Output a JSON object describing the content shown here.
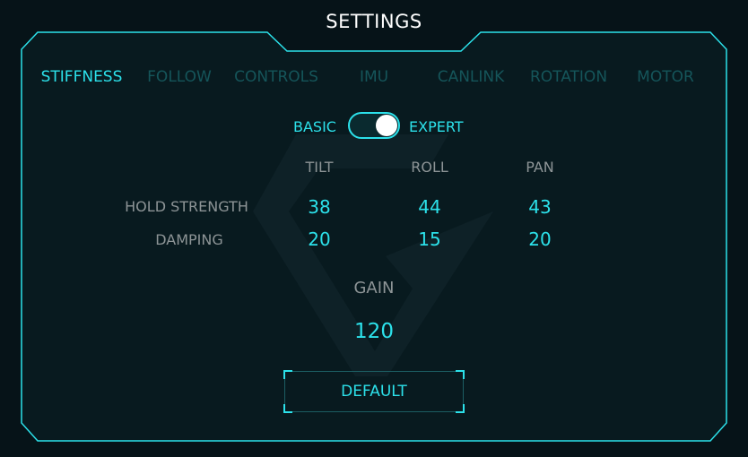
{
  "header": {
    "title": "SETTINGS"
  },
  "tabs": [
    {
      "label": "STIFFNESS",
      "active": true
    },
    {
      "label": "FOLLOW",
      "active": false
    },
    {
      "label": "CONTROLS",
      "active": false
    },
    {
      "label": "IMU",
      "active": false
    },
    {
      "label": "CANLINK",
      "active": false
    },
    {
      "label": "ROTATION",
      "active": false
    },
    {
      "label": "MOTOR",
      "active": false
    }
  ],
  "mode_toggle": {
    "left_label": "BASIC",
    "right_label": "EXPERT",
    "selected": "EXPERT"
  },
  "axes": {
    "tilt": "TILT",
    "roll": "ROLL",
    "pan": "PAN"
  },
  "rows": {
    "hold_strength": {
      "label": "HOLD STRENGTH",
      "tilt": "38",
      "roll": "44",
      "pan": "43"
    },
    "damping": {
      "label": "DAMPING",
      "tilt": "20",
      "roll": "15",
      "pan": "20"
    }
  },
  "gain": {
    "label": "GAIN",
    "value": "120"
  },
  "default_button": {
    "label": "DEFAULT"
  },
  "colors": {
    "accent": "#2ce1ea",
    "inactive_tab": "#15555a",
    "muted_text": "#8d9496",
    "background": "#061318",
    "frame": "#2ce1ea"
  },
  "icons": {
    "watermark": "brand-logo-watermark"
  }
}
